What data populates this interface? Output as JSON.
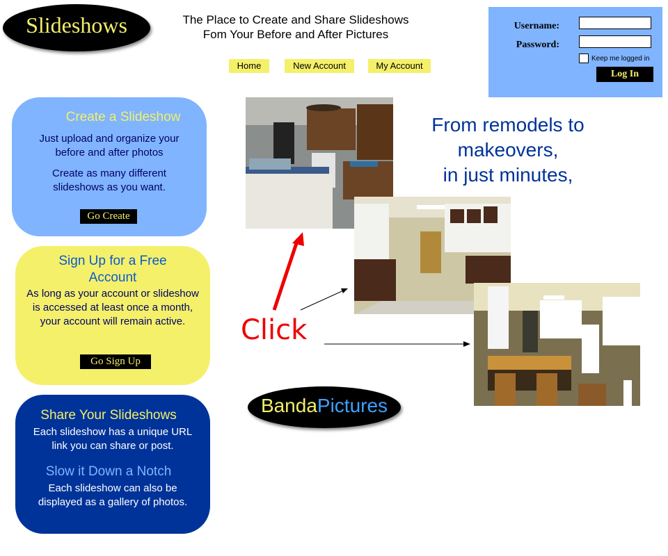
{
  "logo": {
    "text": "Slideshows"
  },
  "tagline": {
    "line1": "The Place to Create and Share Slideshows",
    "line2": "Fom Your Before and After Pictures"
  },
  "nav": [
    {
      "label": "Home"
    },
    {
      "label": "New Account"
    },
    {
      "label": "My Account"
    }
  ],
  "login": {
    "username_label": "Username:",
    "password_label": "Password:",
    "username_value": "",
    "password_value": "",
    "keep_logged_in": "Keep me logged in",
    "button": "Log In"
  },
  "panels": {
    "create": {
      "title": "Create a Slideshow",
      "text1": "Just upload and organize your before and after photos",
      "text2": "Create as many different slideshows as you want.",
      "button": "Go Create"
    },
    "signup": {
      "title": "Sign Up for a Free Account",
      "text": "As long as your account or slideshow is accessed at least once a month, your account will remain active.",
      "button": "Go Sign Up"
    },
    "share": {
      "title": "Share Your Slideshows",
      "text": "Each slideshow has a unique URL link you can share or post.",
      "title2": "Slow it Down a Notch",
      "text2": "Each slideshow can also be displayed as a gallery of photos."
    }
  },
  "headline": {
    "line1": "From remodels to",
    "line2": "makeovers,",
    "line3": "in just minutes,"
  },
  "click_label": "Click",
  "banda": {
    "part1": "Banda",
    "part2": "Pictures"
  },
  "colors": {
    "yellow": "#f4f06a",
    "light_blue": "#80b4ff",
    "dark_blue": "#003399",
    "headline_blue": "#003399",
    "red": "#ee0000"
  }
}
